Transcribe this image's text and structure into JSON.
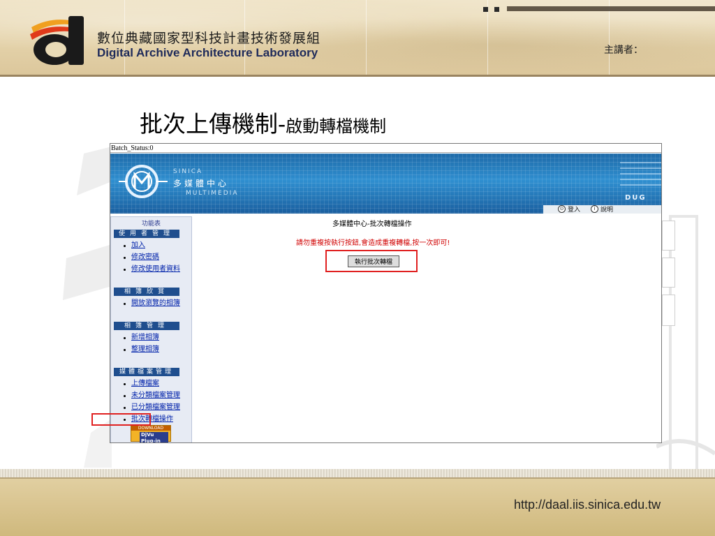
{
  "slide": {
    "org_cn": "數位典藏國家型科技計畫技術發展組",
    "org_en": "Digital Archive Architecture Laboratory",
    "presenter_label": "主講者：",
    "title_main": "批次上傳機制-",
    "title_sub": "啟動轉檔機制",
    "url": "http://daal.iis.sinica.edu.tw"
  },
  "app": {
    "status_text": "Batch_Status:0",
    "banner": {
      "sinica": "SINICA",
      "name_cn": "多媒體中心",
      "multimedia": "MULTIMEDIA",
      "dug": "DUG",
      "login_label": "登入",
      "help_label": "說明"
    },
    "menu": {
      "title": "功能表",
      "sections": [
        {
          "label": "使用者管理",
          "items": [
            "加入",
            "修改密碼",
            "修改使用者資料"
          ]
        },
        {
          "label": "相簿欣賞",
          "items": [
            "開放瀏覽的相簿"
          ]
        },
        {
          "label": "相簿管理",
          "items": [
            "新增相簿",
            "整理相簿"
          ]
        },
        {
          "label": "媒體檔案管理",
          "items": [
            "上傳檔案",
            "未分類檔案管理",
            "已分類檔案管理",
            "批次轉檔操作"
          ]
        }
      ],
      "djvu_top": "DOWNLOAD",
      "djvu_main": "DjVu Plug-in"
    },
    "content": {
      "title": "多媒體中心-批次轉檔操作",
      "warning": "請勿重複按執行按鈕,會造成重複轉檔,按一次即可!",
      "button_label": "執行批次轉檔"
    }
  },
  "colors": {
    "highlight": "#e02020",
    "banner_blue": "#2f8fd0",
    "menu_section": "#1f4e8e",
    "warning_red": "#d00000"
  }
}
